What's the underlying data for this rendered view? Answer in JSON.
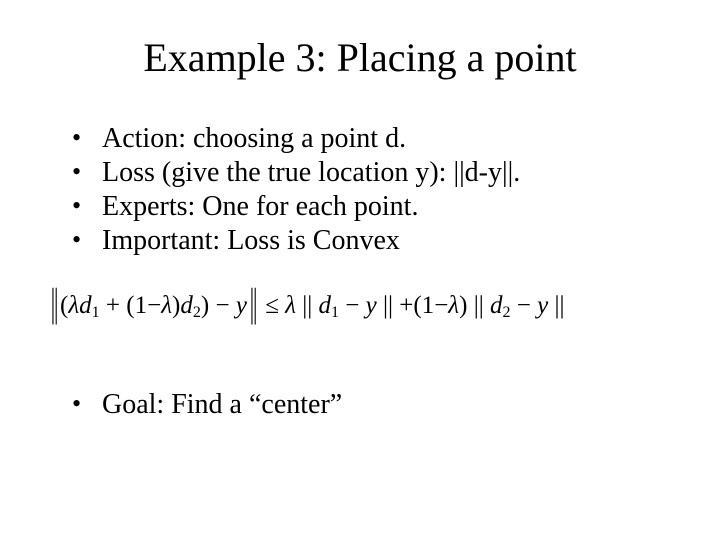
{
  "title": "Example 3: Placing a point",
  "bullets": [
    "Action: choosing a point d.",
    "Loss (give the true location y): ||d-y||.",
    "Experts: One for each point.",
    "Important: Loss is Convex"
  ],
  "formula": {
    "raw": "||(λd₁ + (1−λ)d₂) − y|| ≤ λ || d₁ − y || + (1−λ) || d₂ − y ||",
    "parts": {
      "open_norm": "||",
      "lparen": "(",
      "lambda": "λ",
      "d": "d",
      "sub1": "1",
      "plus": " + ",
      "one_minus": "(1−",
      "rparen": ")",
      "sub2": "2",
      "close_paren": ")",
      "minus_y": " − y",
      "close_norm": "||",
      "leq": " ≤ ",
      "space": " "
    }
  },
  "goal": "Goal: Find a “center”"
}
